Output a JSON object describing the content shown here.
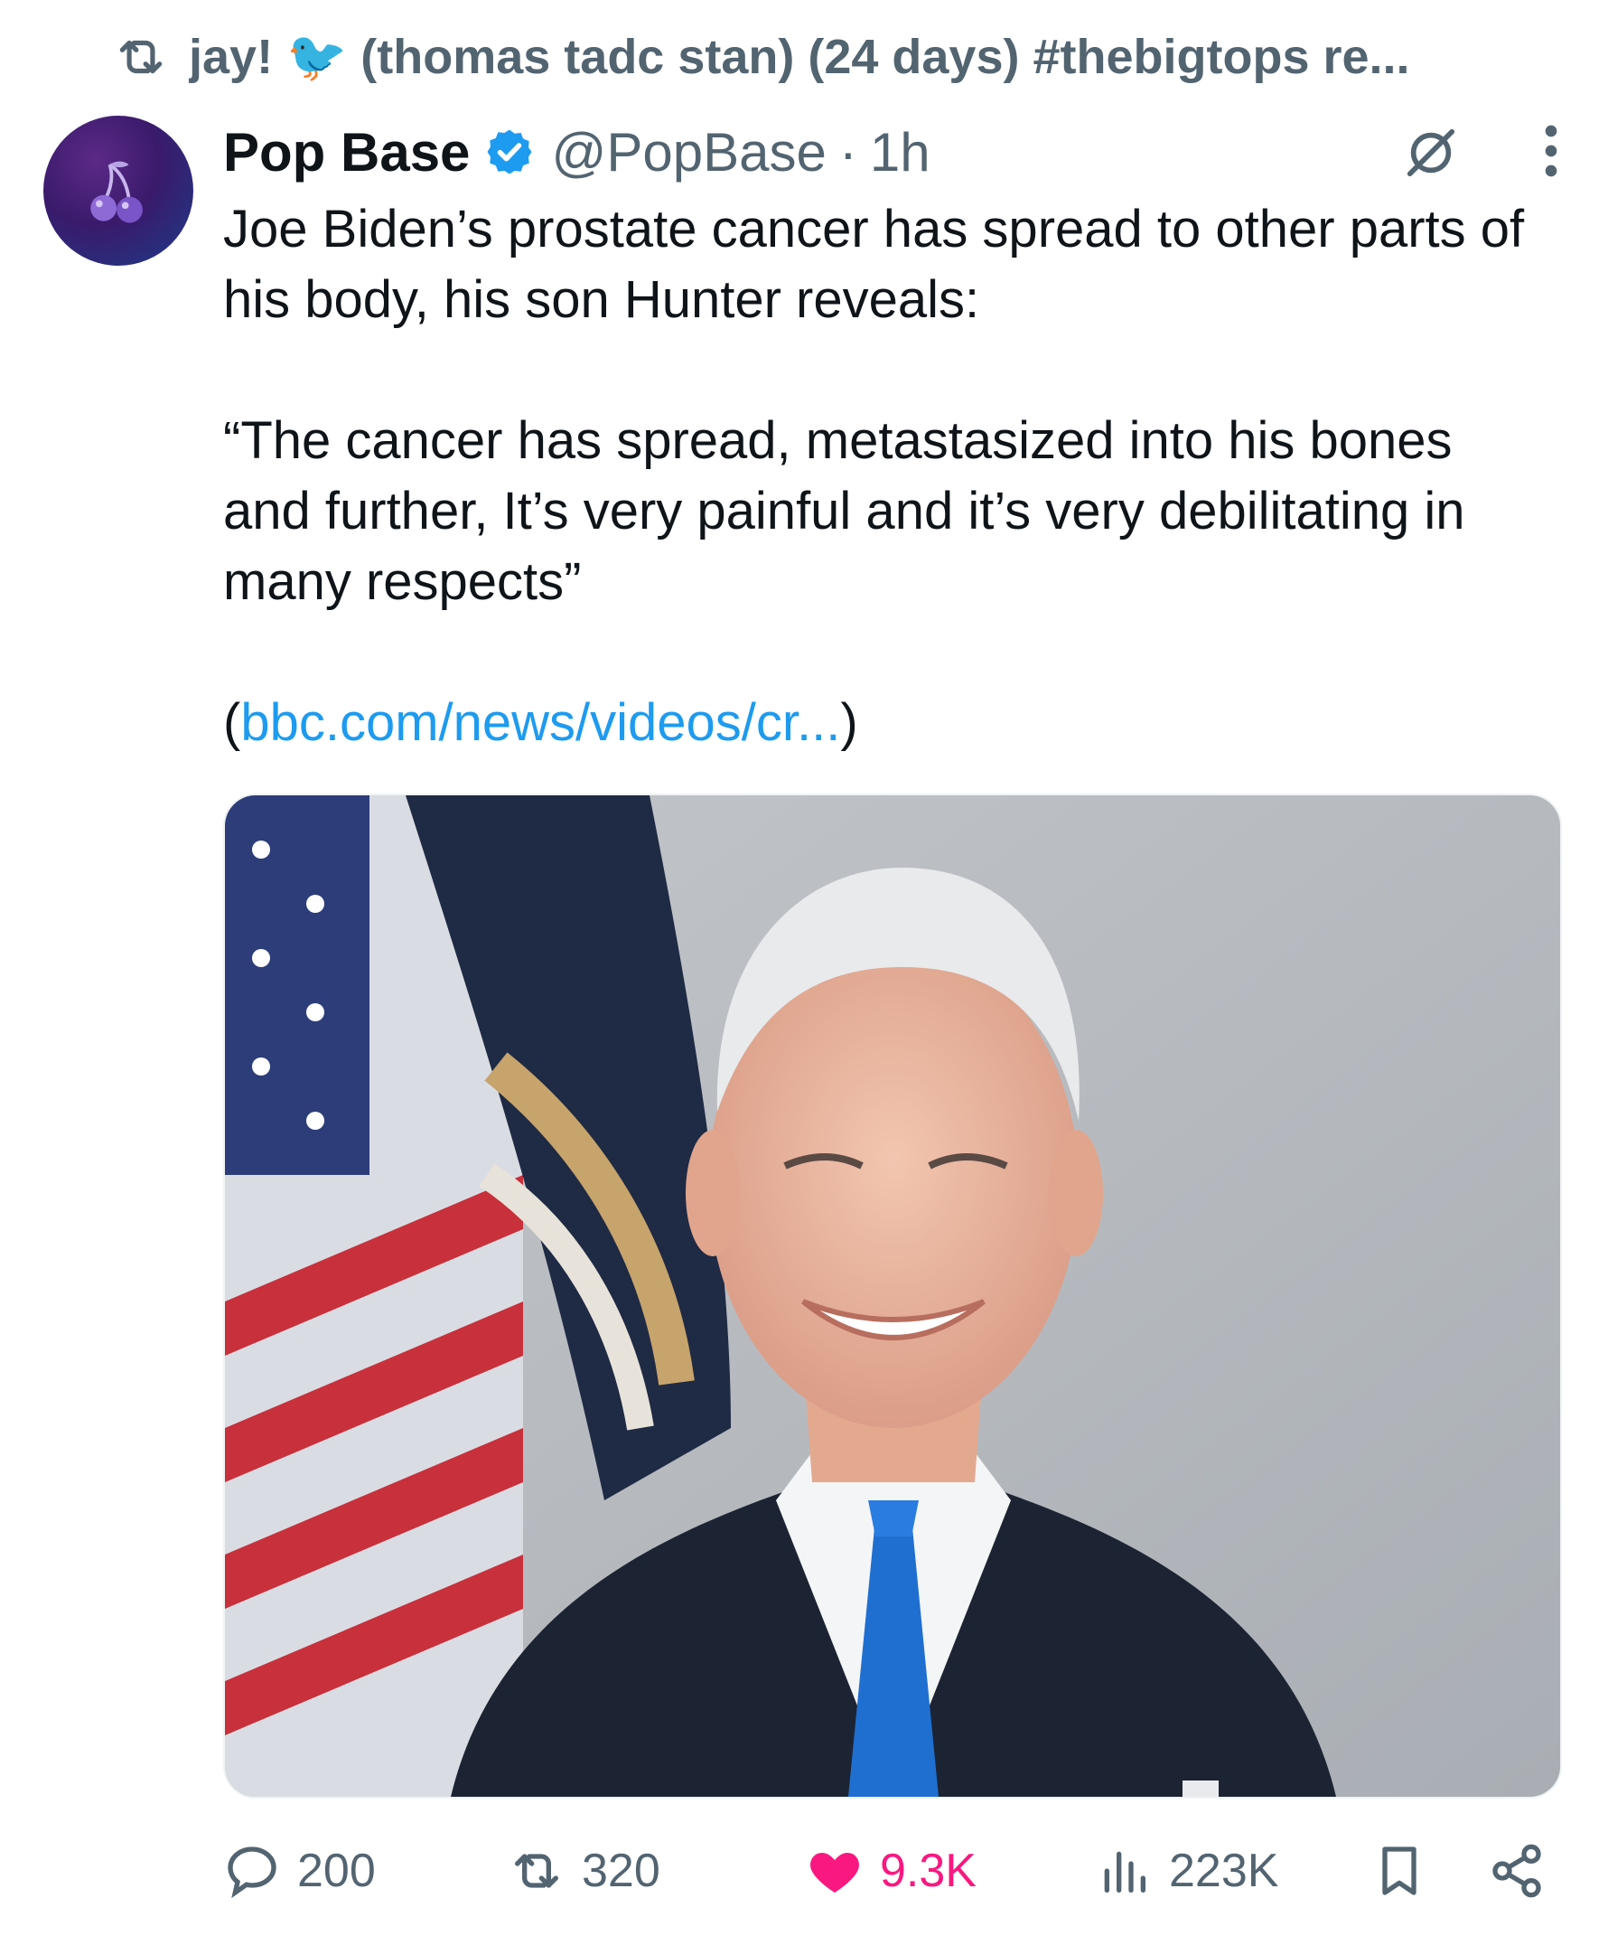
{
  "retweet_context": {
    "text": "jay! 🐦 (thomas tadc stan) (24 days) #thebigtops re..."
  },
  "tweet": {
    "author_name": "Pop Base",
    "handle": "@PopBase",
    "separator": "·",
    "time": "1h",
    "body_para1": "Joe Biden’s prostate cancer has spread to other parts of his body, his son Hunter reveals:",
    "body_para2": "“The cancer has spread, metastasized into his bones and further, It’s very painful and it’s very debilitating in many respects”",
    "link_open": "(",
    "link_text": "bbc.com/news/videos/cr...",
    "link_close": ")"
  },
  "actions": {
    "replies": "200",
    "retweets": "320",
    "likes": "9.3K",
    "views": "223K"
  },
  "colors": {
    "text_primary": "#0f1419",
    "text_secondary": "#536471",
    "link": "#1d9bf0",
    "like": "#f91880",
    "verified": "#1d9bf0"
  },
  "icons": {
    "retweet_context": "retweet-icon",
    "verified": "verified-badge-icon",
    "grok": "grok-icon",
    "more": "more-options-icon",
    "reply": "reply-icon",
    "retweet": "retweet-icon",
    "like": "heart-icon",
    "views": "views-icon",
    "bookmark": "bookmark-icon",
    "share": "share-icon"
  }
}
